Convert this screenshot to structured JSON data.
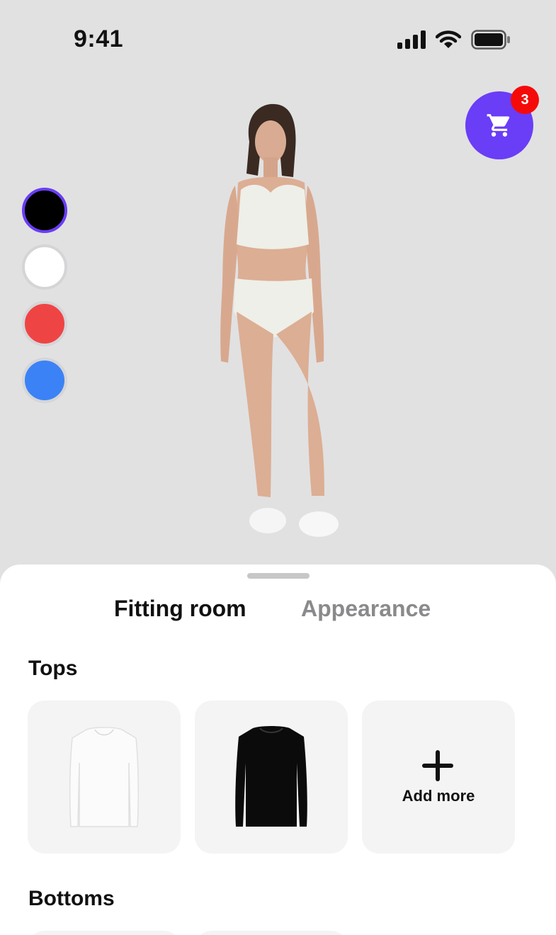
{
  "status_bar": {
    "time": "9:41"
  },
  "cart": {
    "badge_count": "3",
    "accent_color": "#6a3df6",
    "badge_color": "#f50a0a"
  },
  "color_swatches": [
    {
      "name": "black",
      "color": "#000000",
      "selected": true
    },
    {
      "name": "white",
      "color": "#ffffff",
      "selected": false
    },
    {
      "name": "red",
      "color": "#ef4444",
      "selected": false
    },
    {
      "name": "blue",
      "color": "#3b82f6",
      "selected": false
    }
  ],
  "tabs": [
    {
      "label": "Fitting room",
      "active": true
    },
    {
      "label": "Appearance",
      "active": false
    }
  ],
  "sections": {
    "tops": {
      "title": "Tops",
      "items": [
        {
          "name": "white long-sleeve top",
          "color": "#fafafa"
        },
        {
          "name": "black long-sleeve top",
          "color": "#0a0a0a"
        }
      ],
      "add_label": "Add more"
    },
    "bottoms": {
      "title": "Bottoms"
    }
  }
}
